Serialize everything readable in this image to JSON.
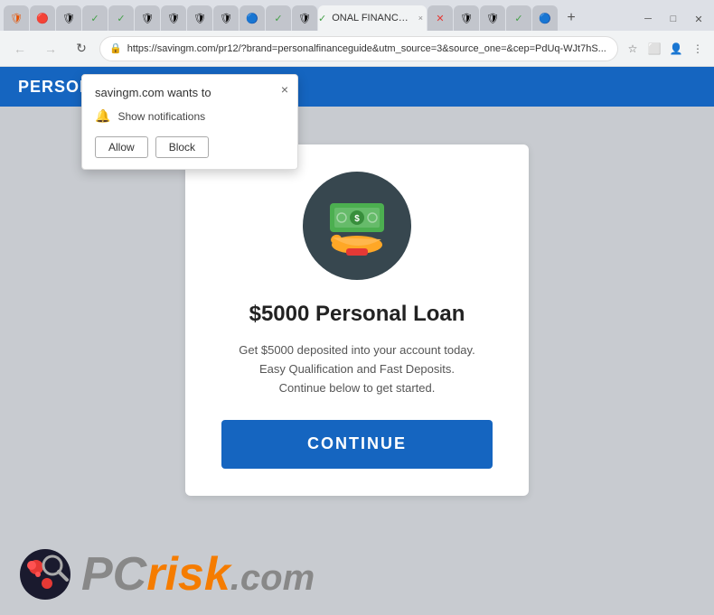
{
  "browser": {
    "url": "https://savingm.com/pr12/?brand=personalfinanceguide&utm_source=3&source_one=&cep=PdUq-WJt7hS...",
    "url_short": "https://savingm.com/pr12/?brand=personalfinanceguide&utm_source=3&source_one=&cep=PdUq-WJt7hS...",
    "active_tab_label": "ONAL FINANCE GUIDE",
    "new_tab_label": "+"
  },
  "tabs": [
    {
      "id": 1,
      "icon": "🛡",
      "active": false
    },
    {
      "id": 2,
      "icon": "🔴",
      "active": false
    },
    {
      "id": 3,
      "icon": "🛡",
      "active": false
    },
    {
      "id": 4,
      "icon": "✓",
      "active": false
    },
    {
      "id": 5,
      "icon": "✓",
      "active": false
    },
    {
      "id": 6,
      "icon": "🛡",
      "active": false
    },
    {
      "id": 7,
      "icon": "🛡",
      "active": false
    },
    {
      "id": 8,
      "icon": "🛡",
      "active": false
    },
    {
      "id": 9,
      "icon": "🛡",
      "active": false
    },
    {
      "id": 10,
      "icon": "🔵",
      "active": false
    },
    {
      "id": 11,
      "icon": "✓",
      "active": false
    },
    {
      "id": 12,
      "icon": "🛡",
      "active": false
    },
    {
      "id": 13,
      "icon": "✓",
      "active": true,
      "label": "ONAL FINANCE GUIDE"
    },
    {
      "id": 14,
      "icon": "×",
      "active": false
    },
    {
      "id": 15,
      "icon": "🛡",
      "active": false
    },
    {
      "id": 16,
      "icon": "🛡",
      "active": false
    },
    {
      "id": 17,
      "icon": "✓",
      "active": false
    },
    {
      "id": 18,
      "icon": "🔵",
      "active": false
    },
    {
      "id": 19,
      "icon": "+",
      "active": false
    }
  ],
  "notification_popup": {
    "title": "savingm.com wants to",
    "notification_text": "Show notifications",
    "allow_label": "Allow",
    "block_label": "Block",
    "close_label": "×"
  },
  "site_header": {
    "title": "ONAL FINANCE GUIDE",
    "full_title": "PERSONAL FINANCE GUIDE",
    "bg_color": "#1565c0"
  },
  "content_card": {
    "title": "$5000 Personal Loan",
    "desc_line1": "Get $5000 deposited into your account today.",
    "desc_line2": "Easy Qualification and Fast Deposits.",
    "desc_line3": "Continue below to get started.",
    "continue_label": "CONTINUE",
    "continue_bg": "#1565c0"
  },
  "pcrisk": {
    "text_pc": "PC",
    "text_risk": "risk",
    "text_com": ".com"
  },
  "window_controls": {
    "minimize": "─",
    "maximize": "□",
    "close": "✕"
  }
}
